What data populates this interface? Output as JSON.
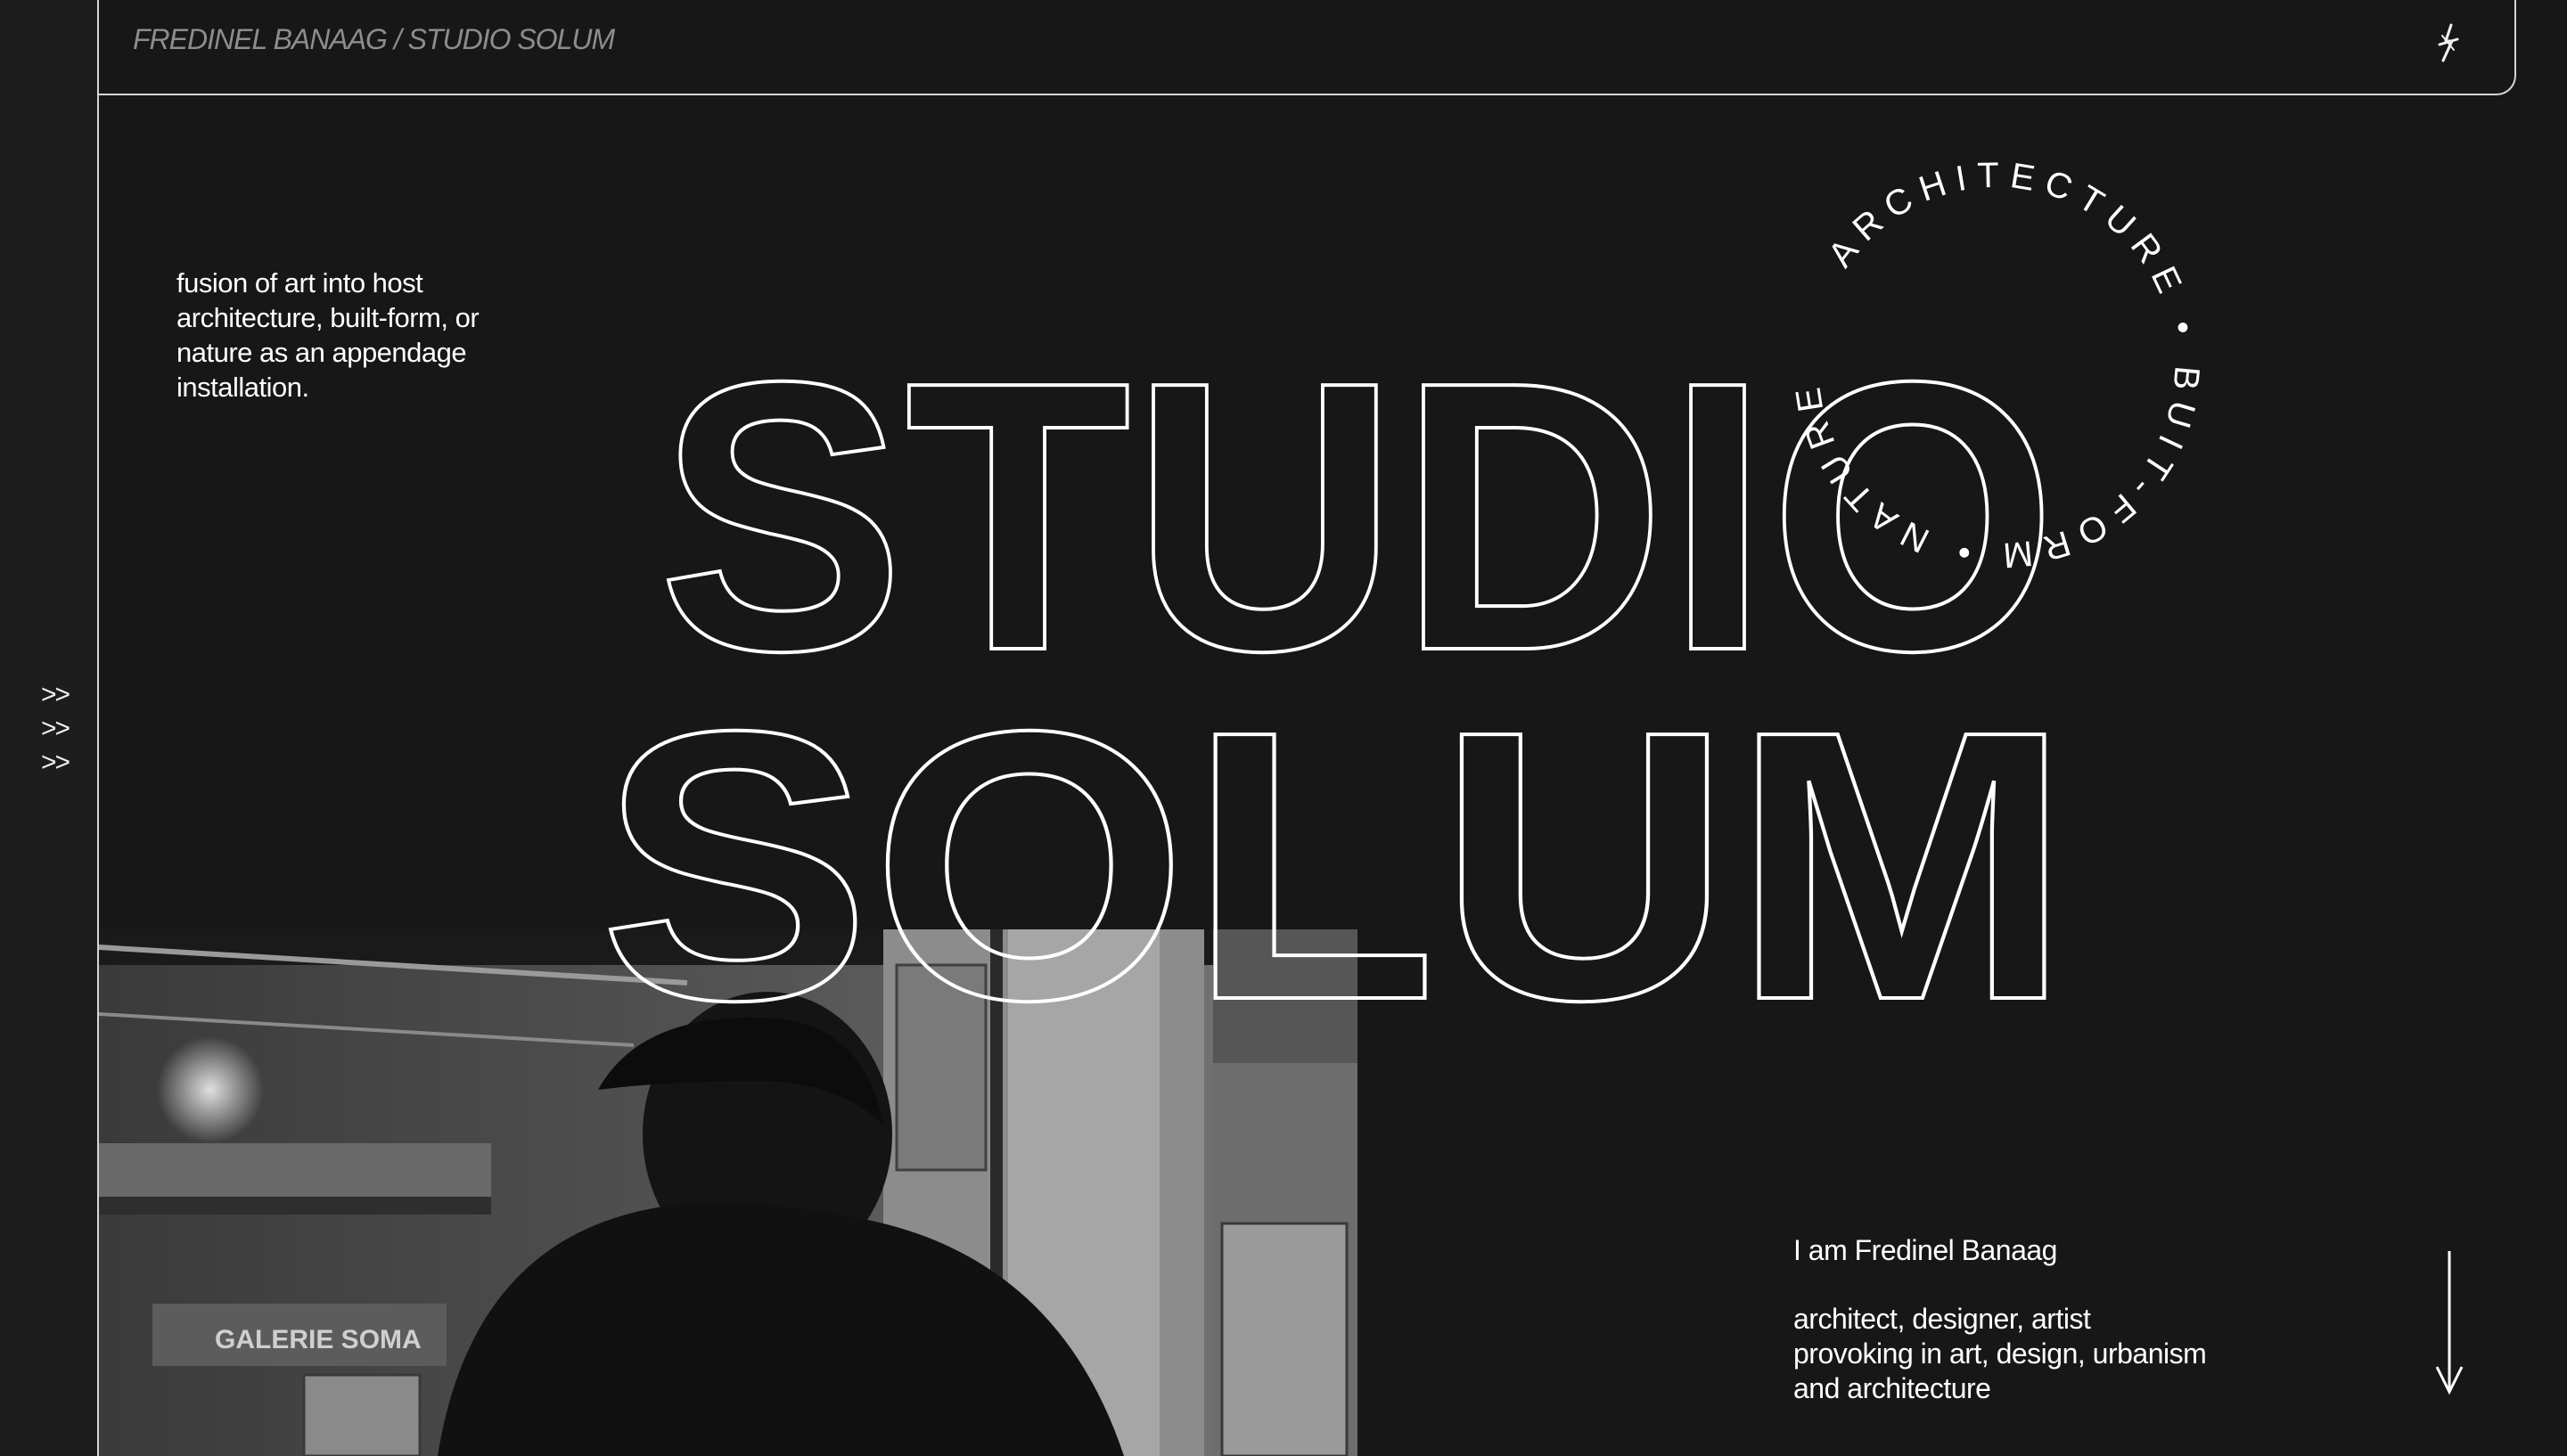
{
  "header": {
    "brand": "FREDINEL BANAAG / STUDIO SOLUM",
    "menu_icon": "lightning-star-icon"
  },
  "left_rail": {
    "arrows": [
      ">>",
      ">>",
      ">>"
    ]
  },
  "intro": {
    "lines": [
      "fusion of art into host",
      "architecture, built-form, or",
      "nature as an appendage",
      "installation."
    ]
  },
  "hero": {
    "line1": "STUDIO",
    "line2": "SOLUM"
  },
  "badge": {
    "ring_text": "ARCHITECTURE • BUIT-FORM • NATURE • "
  },
  "bio": {
    "name": "I am Fredinel Banaag",
    "lines": [
      "architect, designer, artist",
      "provoking in art, design, urbanism",
      "and architecture"
    ]
  },
  "photo": {
    "sign_text": "GALERIE SOMA"
  },
  "scroll": {
    "icon": "arrow-down-icon"
  },
  "colors": {
    "background": "#171717",
    "rail": "#1d1d1d",
    "border": "#d6d6d6",
    "text": "#ffffff",
    "muted": "#8d8d8d"
  }
}
